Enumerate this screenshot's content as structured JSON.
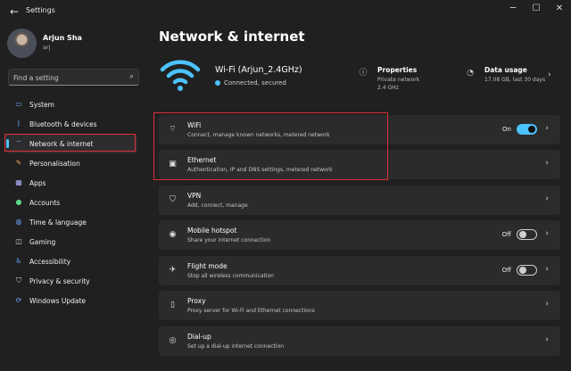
{
  "window": {
    "title": "Settings"
  },
  "user": {
    "name": "Arjun Sha",
    "email": "arj"
  },
  "search": {
    "placeholder": "Find a setting"
  },
  "nav": [
    {
      "label": "System",
      "icon": "monitor-icon",
      "color": "#6aa9ff"
    },
    {
      "label": "Bluetooth & devices",
      "icon": "bluetooth-icon",
      "color": "#6aa9ff"
    },
    {
      "label": "Network & internet",
      "icon": "wifi-icon",
      "color": "#6aa9ff",
      "active": true
    },
    {
      "label": "Personalisation",
      "icon": "brush-icon",
      "color": "#f5a35c"
    },
    {
      "label": "Apps",
      "icon": "apps-icon",
      "color": "#b3b3ff"
    },
    {
      "label": "Accounts",
      "icon": "person-icon",
      "color": "#5fd48c"
    },
    {
      "label": "Time & language",
      "icon": "globe-icon",
      "color": "#6aa9ff"
    },
    {
      "label": "Gaming",
      "icon": "gamepad-icon",
      "color": "#cfcfcf"
    },
    {
      "label": "Accessibility",
      "icon": "accessibility-icon",
      "color": "#6aa9ff"
    },
    {
      "label": "Privacy & security",
      "icon": "shield-icon",
      "color": "#cfcfcf"
    },
    {
      "label": "Windows Update",
      "icon": "update-icon",
      "color": "#6aa9ff"
    }
  ],
  "page": {
    "title": "Network & internet"
  },
  "network": {
    "name": "Wi-Fi (Arjun_2.4GHz)",
    "status": "Connected, secured",
    "properties": {
      "title": "Properties",
      "line1": "Private network",
      "line2": "2.4 GHz"
    },
    "data_usage": {
      "title": "Data usage",
      "line1": "17.08 GB, last 30 days"
    }
  },
  "cards": [
    {
      "title": "WiFi",
      "subtitle": "Connect, manage known networks, metered network",
      "icon": "wifi-icon",
      "toggle": true,
      "on": true,
      "state": "On"
    },
    {
      "title": "Ethernet",
      "subtitle": "Authentication, IP and DNS settings, metered network",
      "icon": "ethernet-icon"
    },
    {
      "title": "VPN",
      "subtitle": "Add, connect, manage",
      "icon": "shield-icon"
    },
    {
      "title": "Mobile hotspot",
      "subtitle": "Share your internet connection",
      "icon": "hotspot-icon",
      "toggle": true,
      "on": false,
      "state": "Off"
    },
    {
      "title": "Flight mode",
      "subtitle": "Stop all wireless communication",
      "icon": "airplane-icon",
      "toggle": true,
      "on": false,
      "state": "Off"
    },
    {
      "title": "Proxy",
      "subtitle": "Proxy server for Wi-Fi and Ethernet connections",
      "icon": "proxy-icon"
    },
    {
      "title": "Dial-up",
      "subtitle": "Set up a dial-up internet connection",
      "icon": "dialup-icon"
    }
  ],
  "colors": {
    "accent": "#4cc2ff",
    "highlight_box": "#e0303a",
    "background": "#202020",
    "card": "#2b2b2b"
  }
}
